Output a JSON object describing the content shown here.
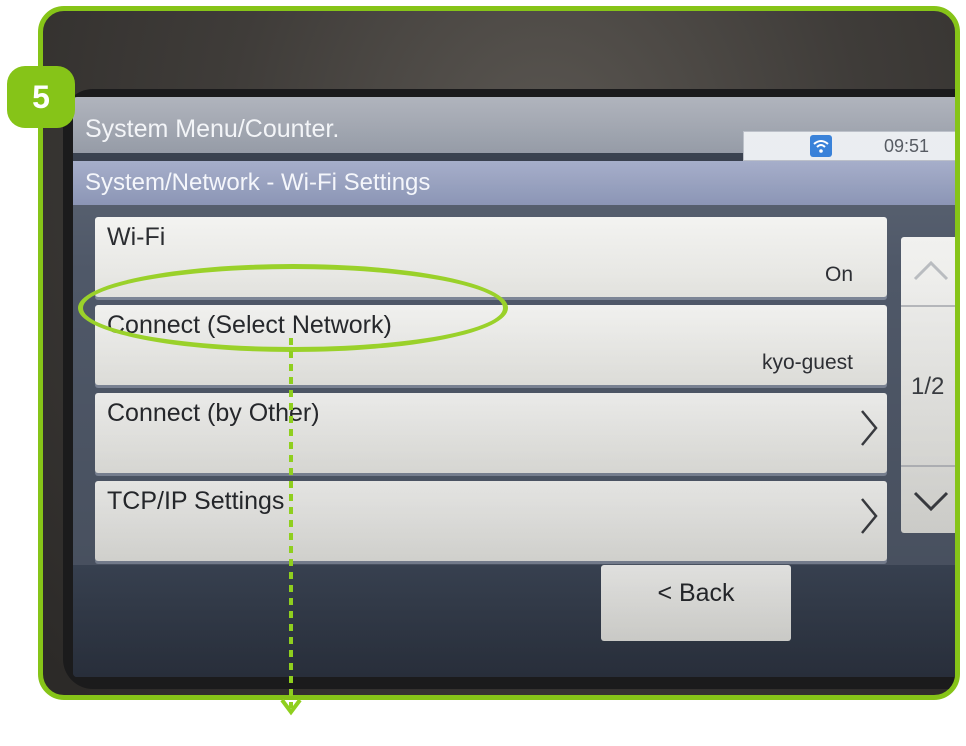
{
  "step": "5",
  "screen": {
    "header_title": "System Menu/Counter.",
    "subheader_title": "System/Network - Wi-Fi Settings",
    "status": {
      "icon": "wifi-icon",
      "time": "09:51"
    }
  },
  "rows": [
    {
      "label": "Wi-Fi",
      "value": "On",
      "chevron": false
    },
    {
      "label": "Connect (Select Network)",
      "value": "kyo-guest",
      "chevron": false
    },
    {
      "label": "Connect (by Other)",
      "value": "",
      "chevron": true
    },
    {
      "label": "TCP/IP Settings",
      "value": "",
      "chevron": true
    }
  ],
  "pager": {
    "page": "1/2"
  },
  "back_label": "< Back",
  "colors": {
    "accent_green": "#86c418",
    "screen_bg": "#2c3443"
  }
}
